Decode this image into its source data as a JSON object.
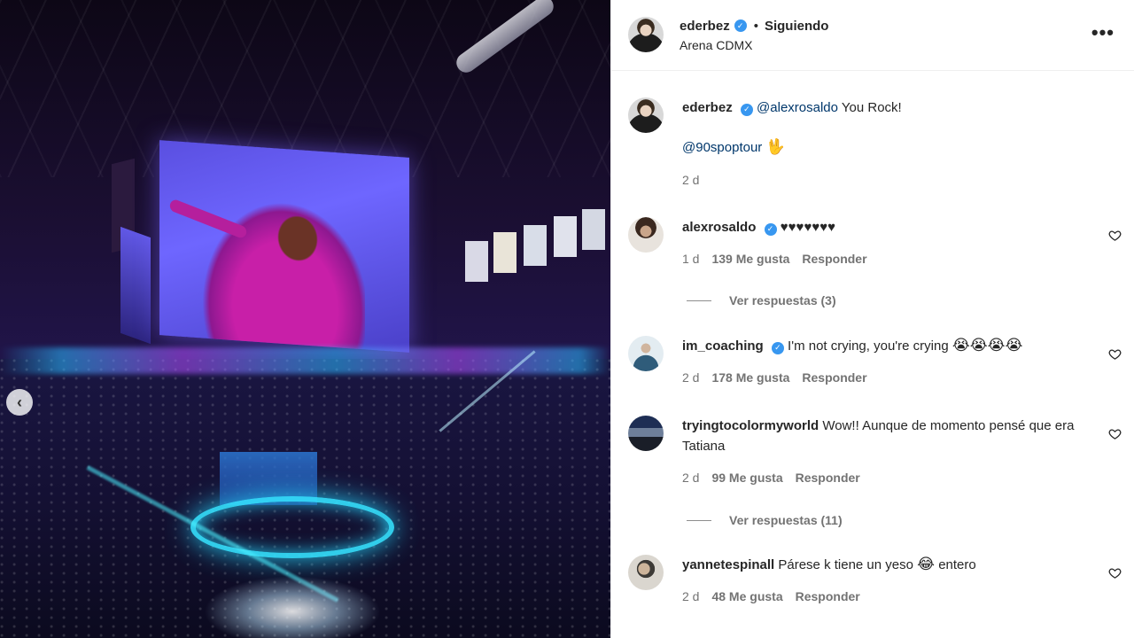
{
  "post": {
    "author": "ederbez",
    "follow_status": "Siguiendo",
    "dot": "•",
    "location": "Arena CDMX",
    "more_label": "•••",
    "verified_mark": "✓"
  },
  "caption": {
    "user": "ederbez",
    "mention": "@alexrosaldo",
    "text": "You Rock!",
    "tag": "@90spoptour",
    "emoji": "🖖",
    "time": "2 d"
  },
  "comments": [
    {
      "user": "alexrosaldo",
      "verified": true,
      "text": "♥♥♥♥♥♥♥",
      "time": "1 d",
      "likes": "139 Me gusta",
      "reply_label": "Responder",
      "view_replies": "Ver respuestas (3)"
    },
    {
      "user": "im_coaching",
      "verified": true,
      "text": "I'm not crying, you're crying",
      "emoji": "😭😭😭😭",
      "time": "2 d",
      "likes": "178 Me gusta",
      "reply_label": "Responder"
    },
    {
      "user": "tryingtocolormyworld",
      "verified": false,
      "text": "Wow!! Aunque de momento pensé que era Tatiana",
      "time": "2 d",
      "likes": "99 Me gusta",
      "reply_label": "Responder",
      "view_replies": "Ver respuestas (11)"
    },
    {
      "user": "yannetespinall",
      "verified": false,
      "text_before": "Párese k tiene un yeso",
      "emoji": "😂",
      "text_after": "entero",
      "time": "2 d",
      "likes": "48 Me gusta",
      "reply_label": "Responder"
    }
  ],
  "icons": {
    "carousel_prev": "chevron-left-icon",
    "like": "heart-outline-icon",
    "verified": "verified-badge-icon",
    "more": "more-horizontal-icon"
  },
  "colors": {
    "verified": "#3897f0",
    "mention": "#00376b",
    "meta": "#737373"
  }
}
